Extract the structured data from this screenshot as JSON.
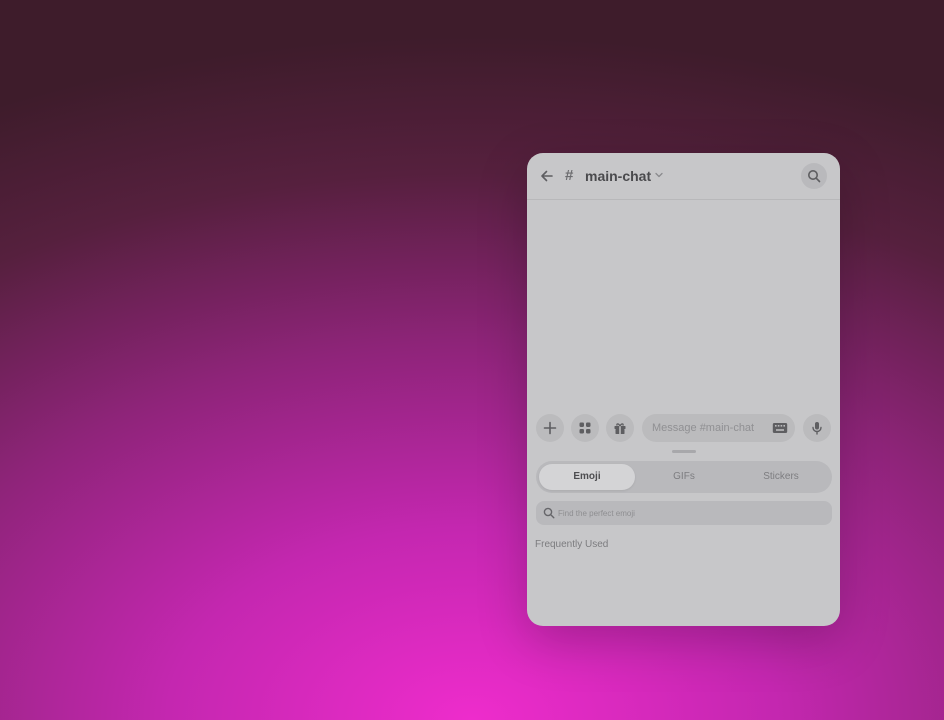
{
  "header": {
    "back_icon": "arrow-left-icon",
    "channel_prefix": "#",
    "channel_name": "main-chat",
    "dropdown_icon": "chevron-down-icon",
    "search_icon": "search-icon"
  },
  "composer": {
    "add_icon": "plus-icon",
    "apps_icon": "apps-grid-icon",
    "gift_icon": "gift-icon",
    "message_placeholder": "Message #main-chat",
    "keyboard_icon": "keyboard-icon",
    "mic_icon": "microphone-icon"
  },
  "picker": {
    "tabs": [
      {
        "label": "Emoji",
        "active": true
      },
      {
        "label": "GIFs",
        "active": false
      },
      {
        "label": "Stickers",
        "active": false
      }
    ],
    "search_placeholder": "Find the perfect emoji",
    "section_label": "Frequently Used"
  },
  "colors": {
    "panel": "#c7c7c9",
    "control": "#bbbbbd",
    "background_top": "#3e1c2b",
    "background_bottom": "#ee2ccc"
  }
}
